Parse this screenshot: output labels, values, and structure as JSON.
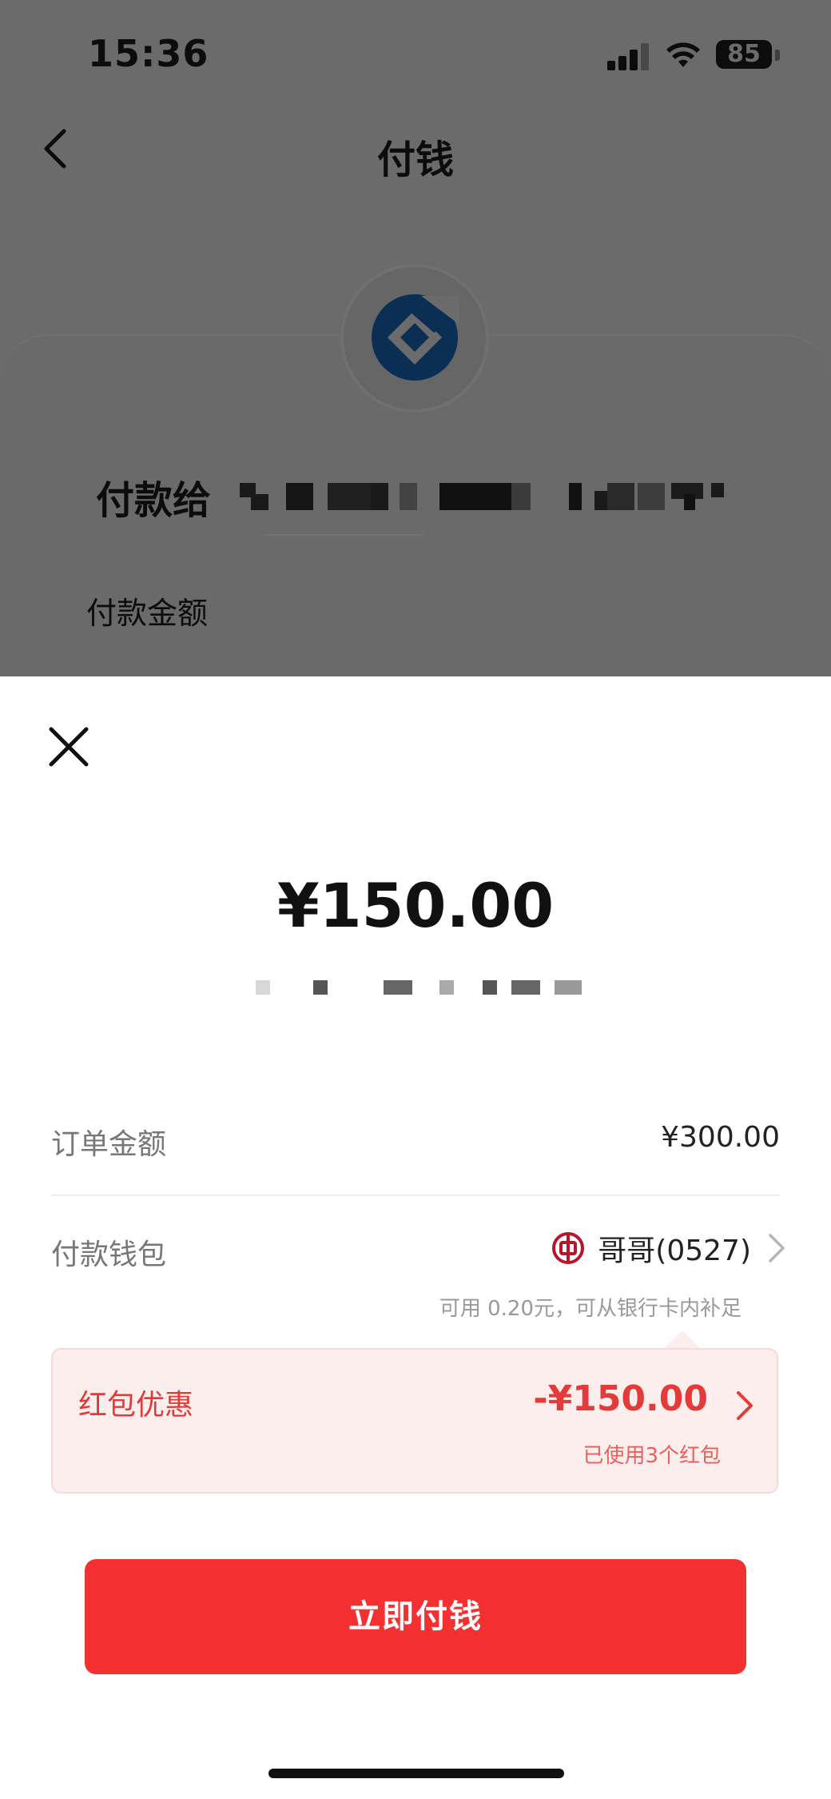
{
  "status_bar": {
    "time": "15:36",
    "battery": "85"
  },
  "header": {
    "title": "付钱"
  },
  "background": {
    "pay_to_label": "付款给",
    "amount_label": "付款金额"
  },
  "sheet": {
    "amount": "¥150.00",
    "order": {
      "label": "订单金额",
      "value": "¥300.00"
    },
    "wallet": {
      "label": "付款钱包",
      "value": "哥哥(0527)",
      "hint": "可用 0.20元，可从银行卡内补足"
    },
    "promo": {
      "label": "红包优惠",
      "amount": "-¥150.00",
      "sub": "已使用3个红包"
    },
    "pay_button": "立即付钱"
  },
  "colors": {
    "accent_red": "#f43030",
    "promo_bg": "#fdeeee",
    "overlay": "#6b6b6b"
  }
}
